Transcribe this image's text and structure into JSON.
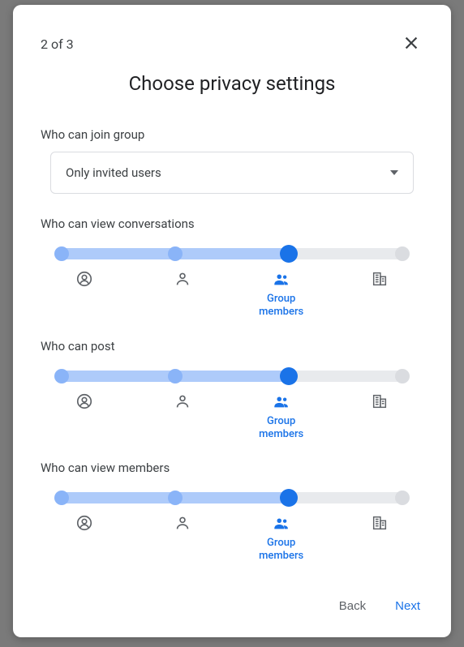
{
  "step_indicator": "2 of 3",
  "title": "Choose privacy settings",
  "dropdown": {
    "label": "Who can join group",
    "value": "Only invited users"
  },
  "sliders": [
    {
      "label": "Who can view conversations",
      "selected_index": 2,
      "stops": [
        {
          "icon": "person-circle",
          "label": ""
        },
        {
          "icon": "person",
          "label": ""
        },
        {
          "icon": "group",
          "label": "Group members"
        },
        {
          "icon": "org",
          "label": ""
        }
      ]
    },
    {
      "label": "Who can post",
      "selected_index": 2,
      "stops": [
        {
          "icon": "person-circle",
          "label": ""
        },
        {
          "icon": "person",
          "label": ""
        },
        {
          "icon": "group",
          "label": "Group members"
        },
        {
          "icon": "org",
          "label": ""
        }
      ]
    },
    {
      "label": "Who can view members",
      "selected_index": 2,
      "stops": [
        {
          "icon": "person-circle",
          "label": ""
        },
        {
          "icon": "person",
          "label": ""
        },
        {
          "icon": "group",
          "label": "Group members"
        },
        {
          "icon": "org",
          "label": ""
        }
      ]
    }
  ],
  "footer": {
    "back": "Back",
    "next": "Next"
  },
  "colors": {
    "track_fill": "#aecbfa",
    "dot_soft": "#8ab4f8",
    "dot_active": "#1a73e8",
    "dot_off": "#dadce0"
  }
}
